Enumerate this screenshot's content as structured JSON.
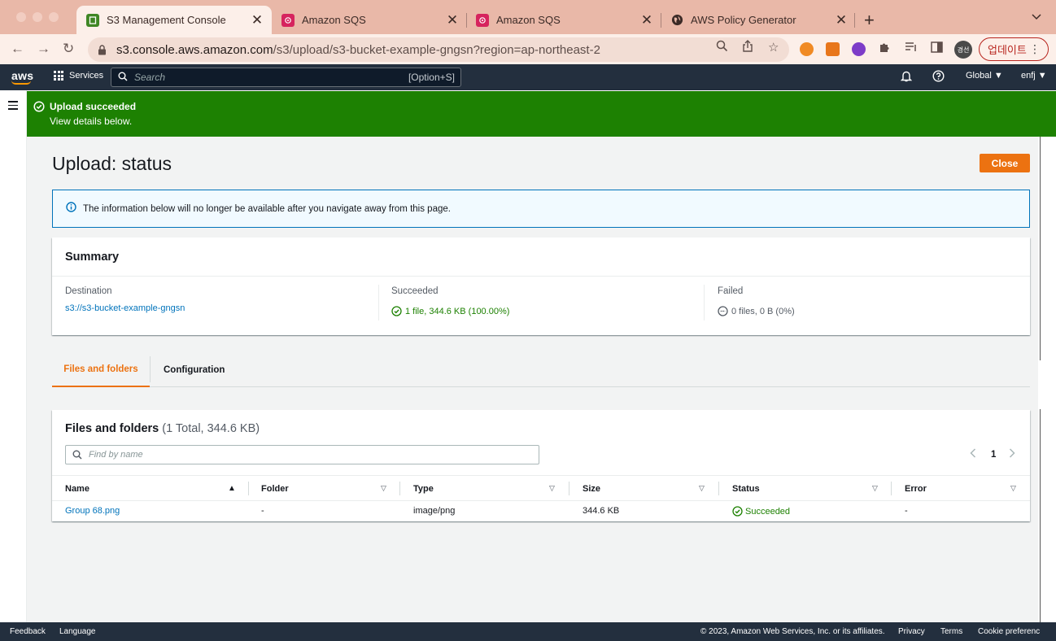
{
  "browser": {
    "tabs": [
      {
        "title": "S3 Management Console",
        "icon": "s3-favicon"
      },
      {
        "title": "Amazon SQS",
        "icon": "sqs-favicon"
      },
      {
        "title": "Amazon SQS",
        "icon": "sqs-favicon"
      },
      {
        "title": "AWS Policy Generator",
        "icon": "globe-favicon"
      }
    ],
    "url_host": "s3.console.aws.amazon.com",
    "url_path": "/s3/upload/s3-bucket-example-gngsn?region=ap-northeast-2",
    "profile_label": "경선",
    "update_label": "업데이트"
  },
  "aws_nav": {
    "logo": "aws",
    "services_label": "Services",
    "search_placeholder": "Search",
    "search_shortcut": "[Option+S]",
    "region": "Global ▼",
    "account": "enfj ▼"
  },
  "flash": {
    "title": "Upload succeeded",
    "message": "View details below."
  },
  "page": {
    "title": "Upload: status",
    "close_label": "Close",
    "info_text": "The information below will no longer be available after you navigate away from this page."
  },
  "summary": {
    "header": "Summary",
    "destination_label": "Destination",
    "destination_value": "s3://s3-bucket-example-gngsn",
    "succeeded_label": "Succeeded",
    "succeeded_value": "1 file, 344.6 KB (100.00%)",
    "failed_label": "Failed",
    "failed_value": "0 files, 0 B (0%)"
  },
  "tabs": [
    {
      "label": "Files and folders",
      "selected": true
    },
    {
      "label": "Configuration",
      "selected": false
    }
  ],
  "files": {
    "header": "Files and folders",
    "count": "(1 Total, 344.6 KB)",
    "find_placeholder": "Find by name",
    "page": "1",
    "columns": [
      "Name",
      "Folder",
      "Type",
      "Size",
      "Status",
      "Error"
    ],
    "rows": [
      {
        "name": "Group 68.png",
        "folder": "-",
        "type": "image/png",
        "size": "344.6 KB",
        "status": "Succeeded",
        "error": "-"
      }
    ]
  },
  "footer": {
    "feedback": "Feedback",
    "language": "Language",
    "copyright": "© 2023, Amazon Web Services, Inc. or its affiliates.",
    "privacy": "Privacy",
    "terms": "Terms",
    "cookie": "Cookie preferenc"
  },
  "colors": {
    "success": "#1d8102",
    "accent_orange": "#ec7211",
    "link": "#0073bb",
    "aws_nav": "#232f3e"
  }
}
